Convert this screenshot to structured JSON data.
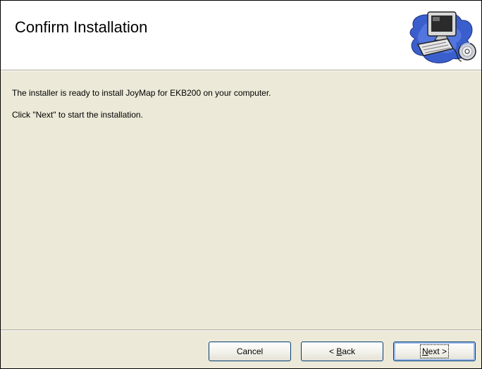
{
  "header": {
    "title": "Confirm Installation",
    "graphic_icon": "computer-cd-icon"
  },
  "content": {
    "line1": "The installer is ready to install JoyMap for EKB200 on your computer.",
    "line2": "Click \"Next\" to start the installation."
  },
  "buttons": {
    "cancel_label": "Cancel",
    "back_prefix": "< ",
    "back_mnemonic": "B",
    "back_rest": "ack",
    "next_mnemonic": "N",
    "next_rest": "ext >"
  },
  "colors": {
    "background": "#ece9d8",
    "header_background": "#ffffff",
    "button_border": "#003c74",
    "default_button_ring": "#9db9eb"
  }
}
